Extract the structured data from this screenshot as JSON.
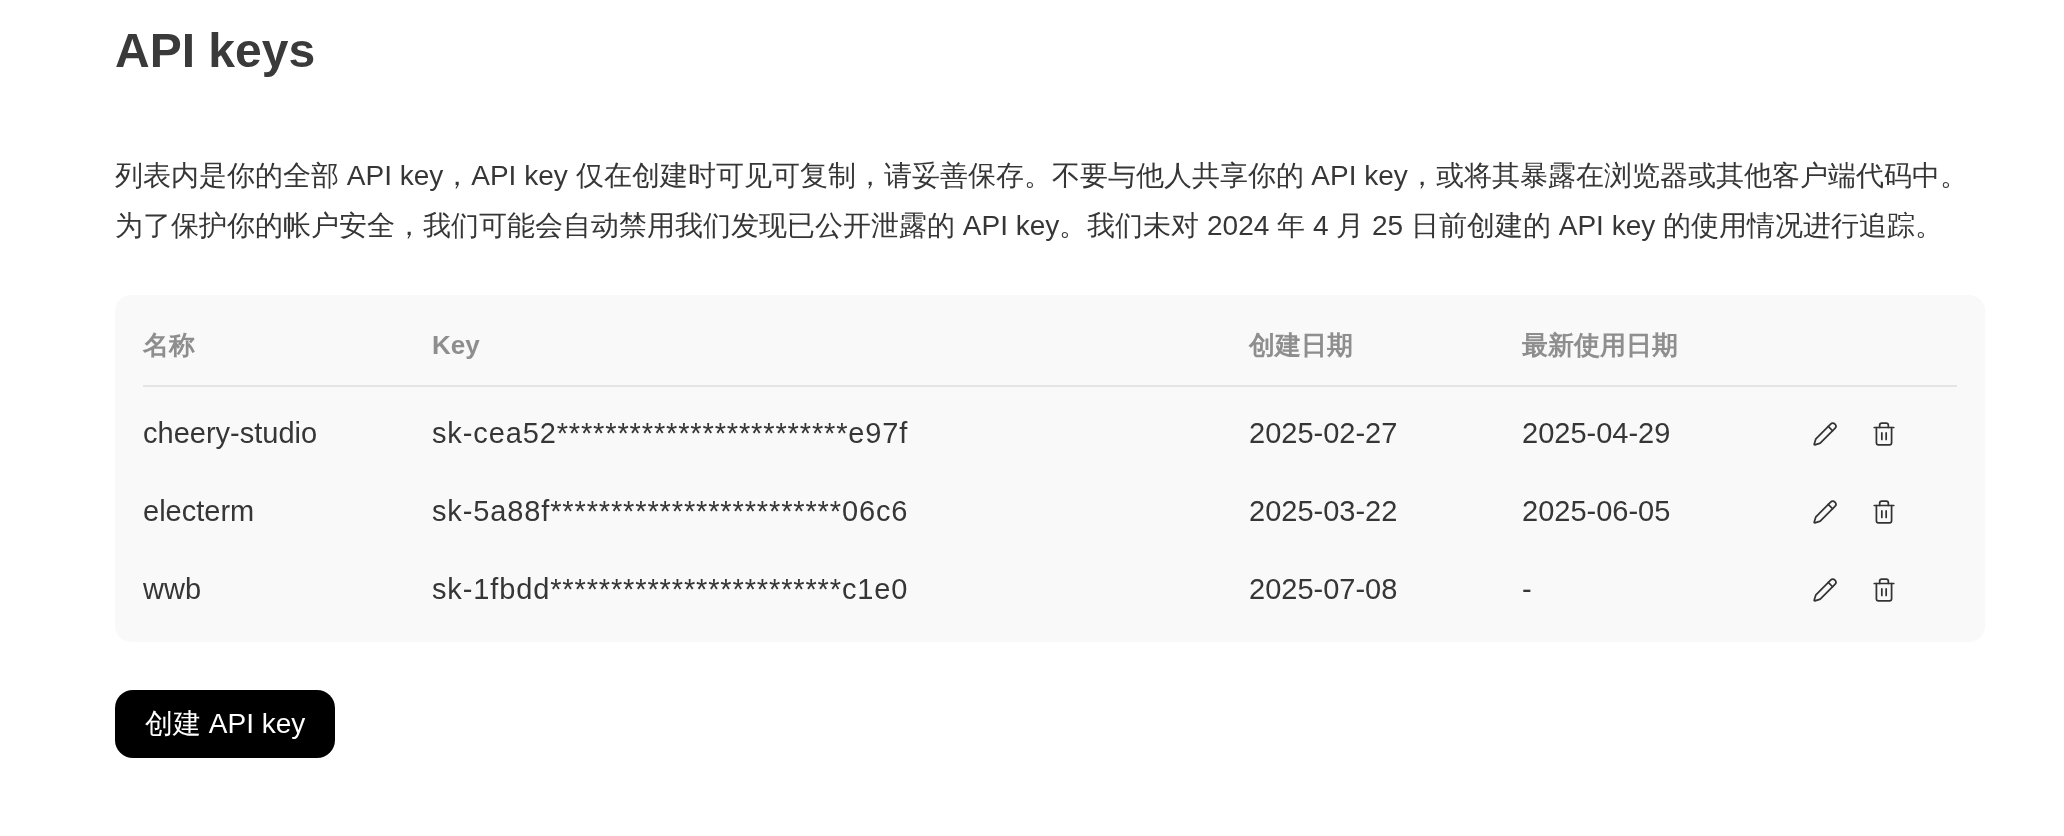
{
  "page": {
    "title": "API keys",
    "description": [
      "列表内是你的全部 API key，API key 仅在创建时可见可复制，请妥善保存。不要与他人共享你的 API key，或将其暴露在浏览器或其他客户端代码中。",
      "为了保护你的帐户安全，我们可能会自动禁用我们发现已公开泄露的 API key。我们未对 2024 年 4 月 25 日前创建的 API key 的使用情况进行追踪。"
    ]
  },
  "table": {
    "columns": [
      "名称",
      "Key",
      "创建日期",
      "最新使用日期"
    ],
    "rows": [
      {
        "name": "cheery-studio",
        "key": "sk-cea52************************e97f",
        "created": "2025-02-27",
        "last_used": "2025-04-29"
      },
      {
        "name": "electerm",
        "key": "sk-5a88f************************06c6",
        "created": "2025-03-22",
        "last_used": "2025-06-05"
      },
      {
        "name": "wwb",
        "key": "sk-1fbdd************************c1e0",
        "created": "2025-07-08",
        "last_used": "-"
      }
    ]
  },
  "create_button": {
    "label": "创建 API key"
  }
}
